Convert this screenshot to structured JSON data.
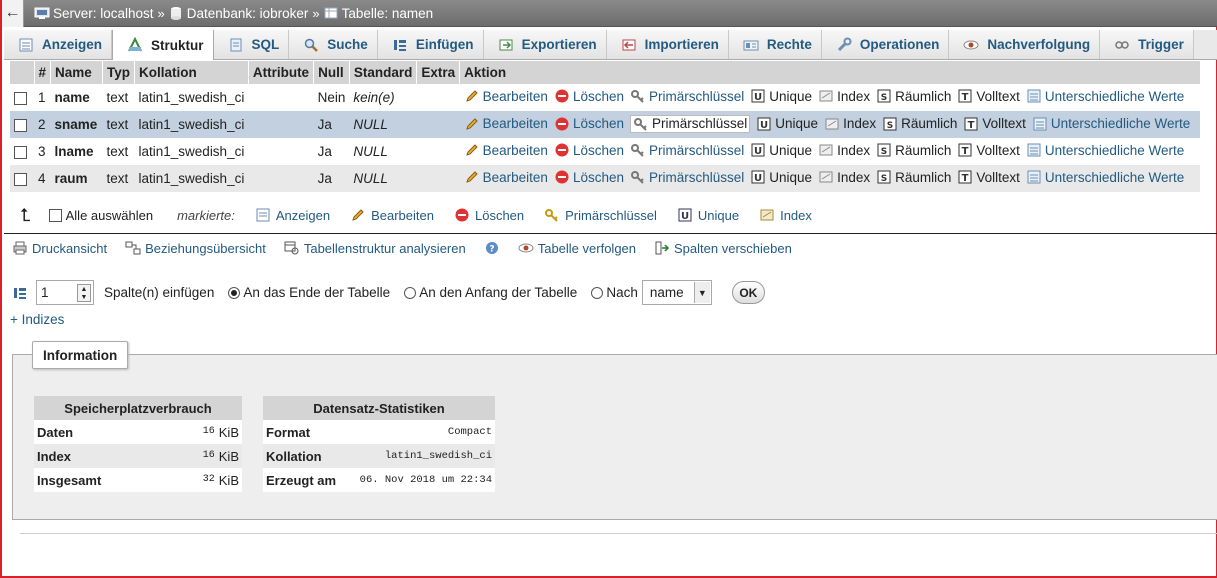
{
  "breadcrumb": {
    "back": "←",
    "server": "Server: localhost",
    "database": "Datenbank: iobroker",
    "table": "Tabelle: namen",
    "separator": "»"
  },
  "tabs": [
    {
      "label": "Anzeigen",
      "icon": "browse-icon"
    },
    {
      "label": "Struktur",
      "icon": "structure-icon"
    },
    {
      "label": "SQL",
      "icon": "sql-icon"
    },
    {
      "label": "Suche",
      "icon": "search-icon"
    },
    {
      "label": "Einfügen",
      "icon": "insert-icon"
    },
    {
      "label": "Exportieren",
      "icon": "export-icon"
    },
    {
      "label": "Importieren",
      "icon": "import-icon"
    },
    {
      "label": "Rechte",
      "icon": "privileges-icon"
    },
    {
      "label": "Operationen",
      "icon": "wrench-icon"
    },
    {
      "label": "Nachverfolgung",
      "icon": "eye-icon"
    },
    {
      "label": "Trigger",
      "icon": "trigger-icon"
    }
  ],
  "structure": {
    "headers": [
      "#",
      "Name",
      "Typ",
      "Kollation",
      "Attribute",
      "Null",
      "Standard",
      "Extra",
      "Aktion"
    ],
    "rows": [
      {
        "num": "1",
        "name": "name",
        "type": "text",
        "collation": "latin1_swedish_ci",
        "attributes": "",
        "null": "Nein",
        "default": "kein(e)",
        "extra": ""
      },
      {
        "num": "2",
        "name": "sname",
        "type": "text",
        "collation": "latin1_swedish_ci",
        "attributes": "",
        "null": "Ja",
        "default": "NULL",
        "extra": ""
      },
      {
        "num": "3",
        "name": "lname",
        "type": "text",
        "collation": "latin1_swedish_ci",
        "attributes": "",
        "null": "Ja",
        "default": "NULL",
        "extra": ""
      },
      {
        "num": "4",
        "name": "raum",
        "type": "text",
        "collation": "latin1_swedish_ci",
        "attributes": "",
        "null": "Ja",
        "default": "NULL",
        "extra": ""
      }
    ],
    "actions": {
      "edit": "Bearbeiten",
      "delete": "Löschen",
      "primary": "Primärschlüssel",
      "unique": "Unique",
      "index": "Index",
      "spatial": "Räumlich",
      "fulltext": "Volltext",
      "distinct": "Unterschiedliche Werte"
    }
  },
  "bulk": {
    "select_all": "Alle auswählen",
    "marked": "markierte:",
    "browse": "Anzeigen",
    "edit": "Bearbeiten",
    "delete": "Löschen",
    "primary": "Primärschlüssel",
    "unique": "Unique",
    "index": "Index"
  },
  "links": {
    "print": "Druckansicht",
    "relations": "Beziehungsübersicht",
    "analyze": "Tabellenstruktur analysieren",
    "track": "Tabelle verfolgen",
    "move": "Spalten verschieben"
  },
  "add_column": {
    "count": "1",
    "label": "Spalte(n) einfügen",
    "opt_end": "An das Ende der Tabelle",
    "opt_begin": "An den Anfang der Tabelle",
    "opt_after": "Nach",
    "after_value": "name",
    "ok": "OK"
  },
  "indexes_link": "+ Indizes",
  "information": {
    "legend": "Information",
    "space": {
      "title": "Speicherplatzverbrauch",
      "rows": [
        {
          "label": "Daten",
          "value": "16",
          "unit": "KiB"
        },
        {
          "label": "Index",
          "value": "16",
          "unit": "KiB"
        },
        {
          "label": "Insgesamt",
          "value": "32",
          "unit": "KiB"
        }
      ]
    },
    "stats": {
      "title": "Datensatz-Statistiken",
      "rows": [
        {
          "label": "Format",
          "value": "Compact"
        },
        {
          "label": "Kollation",
          "value": "latin1_swedish_ci"
        },
        {
          "label": "Erzeugt am",
          "value": "06. Nov 2018 um 22:34"
        }
      ]
    }
  }
}
